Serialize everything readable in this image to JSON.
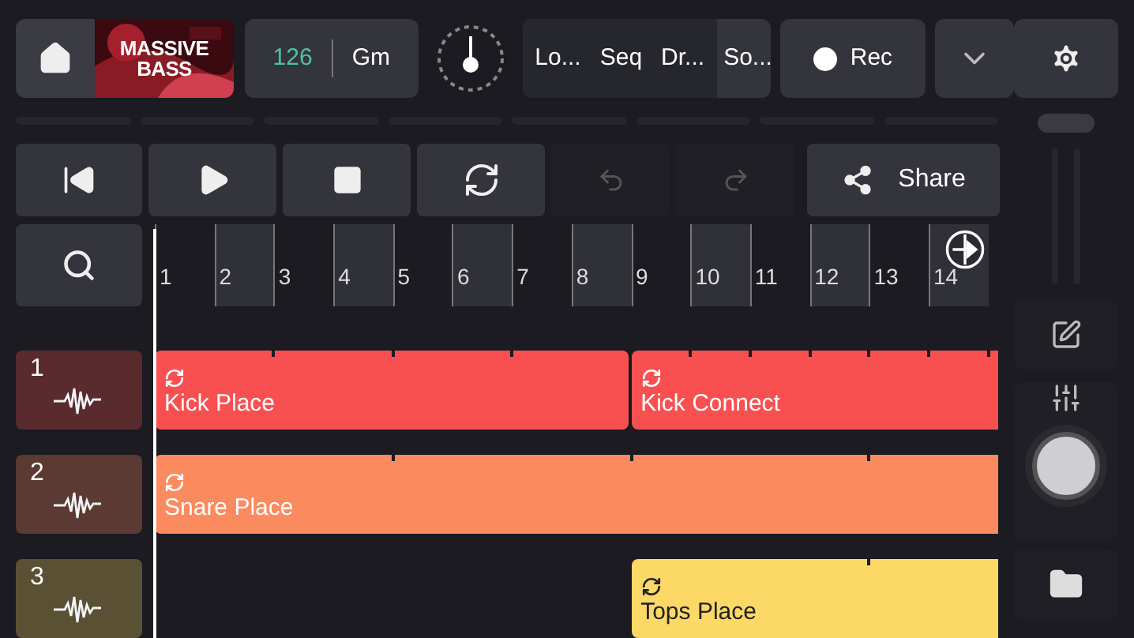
{
  "top_bar": {
    "album_title": "MASSIVE BASS",
    "tempo": "126",
    "key": "Gm",
    "tabs": [
      {
        "label": "Lo..."
      },
      {
        "label": "Seq"
      },
      {
        "label": "Dr..."
      },
      {
        "label": "So..."
      }
    ],
    "record": {
      "label": "Rec"
    }
  },
  "transport": {
    "undo": {
      "disabled": true
    },
    "redo": {
      "disabled": true
    },
    "share": {
      "label": "Share"
    }
  },
  "ruler": {
    "bars": [
      "1",
      "2",
      "3",
      "4",
      "5",
      "6",
      "7",
      "8",
      "9",
      "10",
      "11",
      "12",
      "13",
      "14"
    ]
  },
  "tracks": [
    {
      "number": "1",
      "color": "#f85050",
      "clips": [
        {
          "kind": "clip",
          "name": "Kick Place",
          "segments": [
            {
              "kind": "half"
            },
            {
              "kind": "half"
            },
            {
              "kind": "half"
            },
            {
              "kind": "half"
            }
          ]
        },
        {
          "kind": "clip",
          "name": "Kick Connect",
          "segments": [
            {
              "kind": "bar"
            },
            {
              "kind": "bar"
            },
            {
              "kind": "bar"
            },
            {
              "kind": "bar"
            },
            {
              "kind": "bar"
            },
            {
              "kind": "bar"
            },
            {
              "kind": "bar"
            }
          ]
        }
      ]
    },
    {
      "number": "2",
      "color": "#fb8a5e",
      "clips": [
        {
          "kind": "clip",
          "name": "Snare Place",
          "segments": [
            {
              "kind": "phrase"
            },
            {
              "kind": "phrase"
            },
            {
              "kind": "phrase"
            },
            {
              "kind": "phrase"
            }
          ]
        }
      ]
    },
    {
      "number": "3",
      "color": "#fcd866",
      "clips": [
        {
          "kind": "gap",
          "segments": [
            {
              "kind": "half"
            },
            {
              "kind": "half"
            },
            {
              "kind": "half"
            },
            {
              "kind": "half"
            }
          ]
        },
        {
          "kind": "clip",
          "name": "Tops Place",
          "segments": [
            {
              "kind": "phrase"
            },
            {
              "kind": "phrase"
            }
          ]
        }
      ]
    }
  ]
}
